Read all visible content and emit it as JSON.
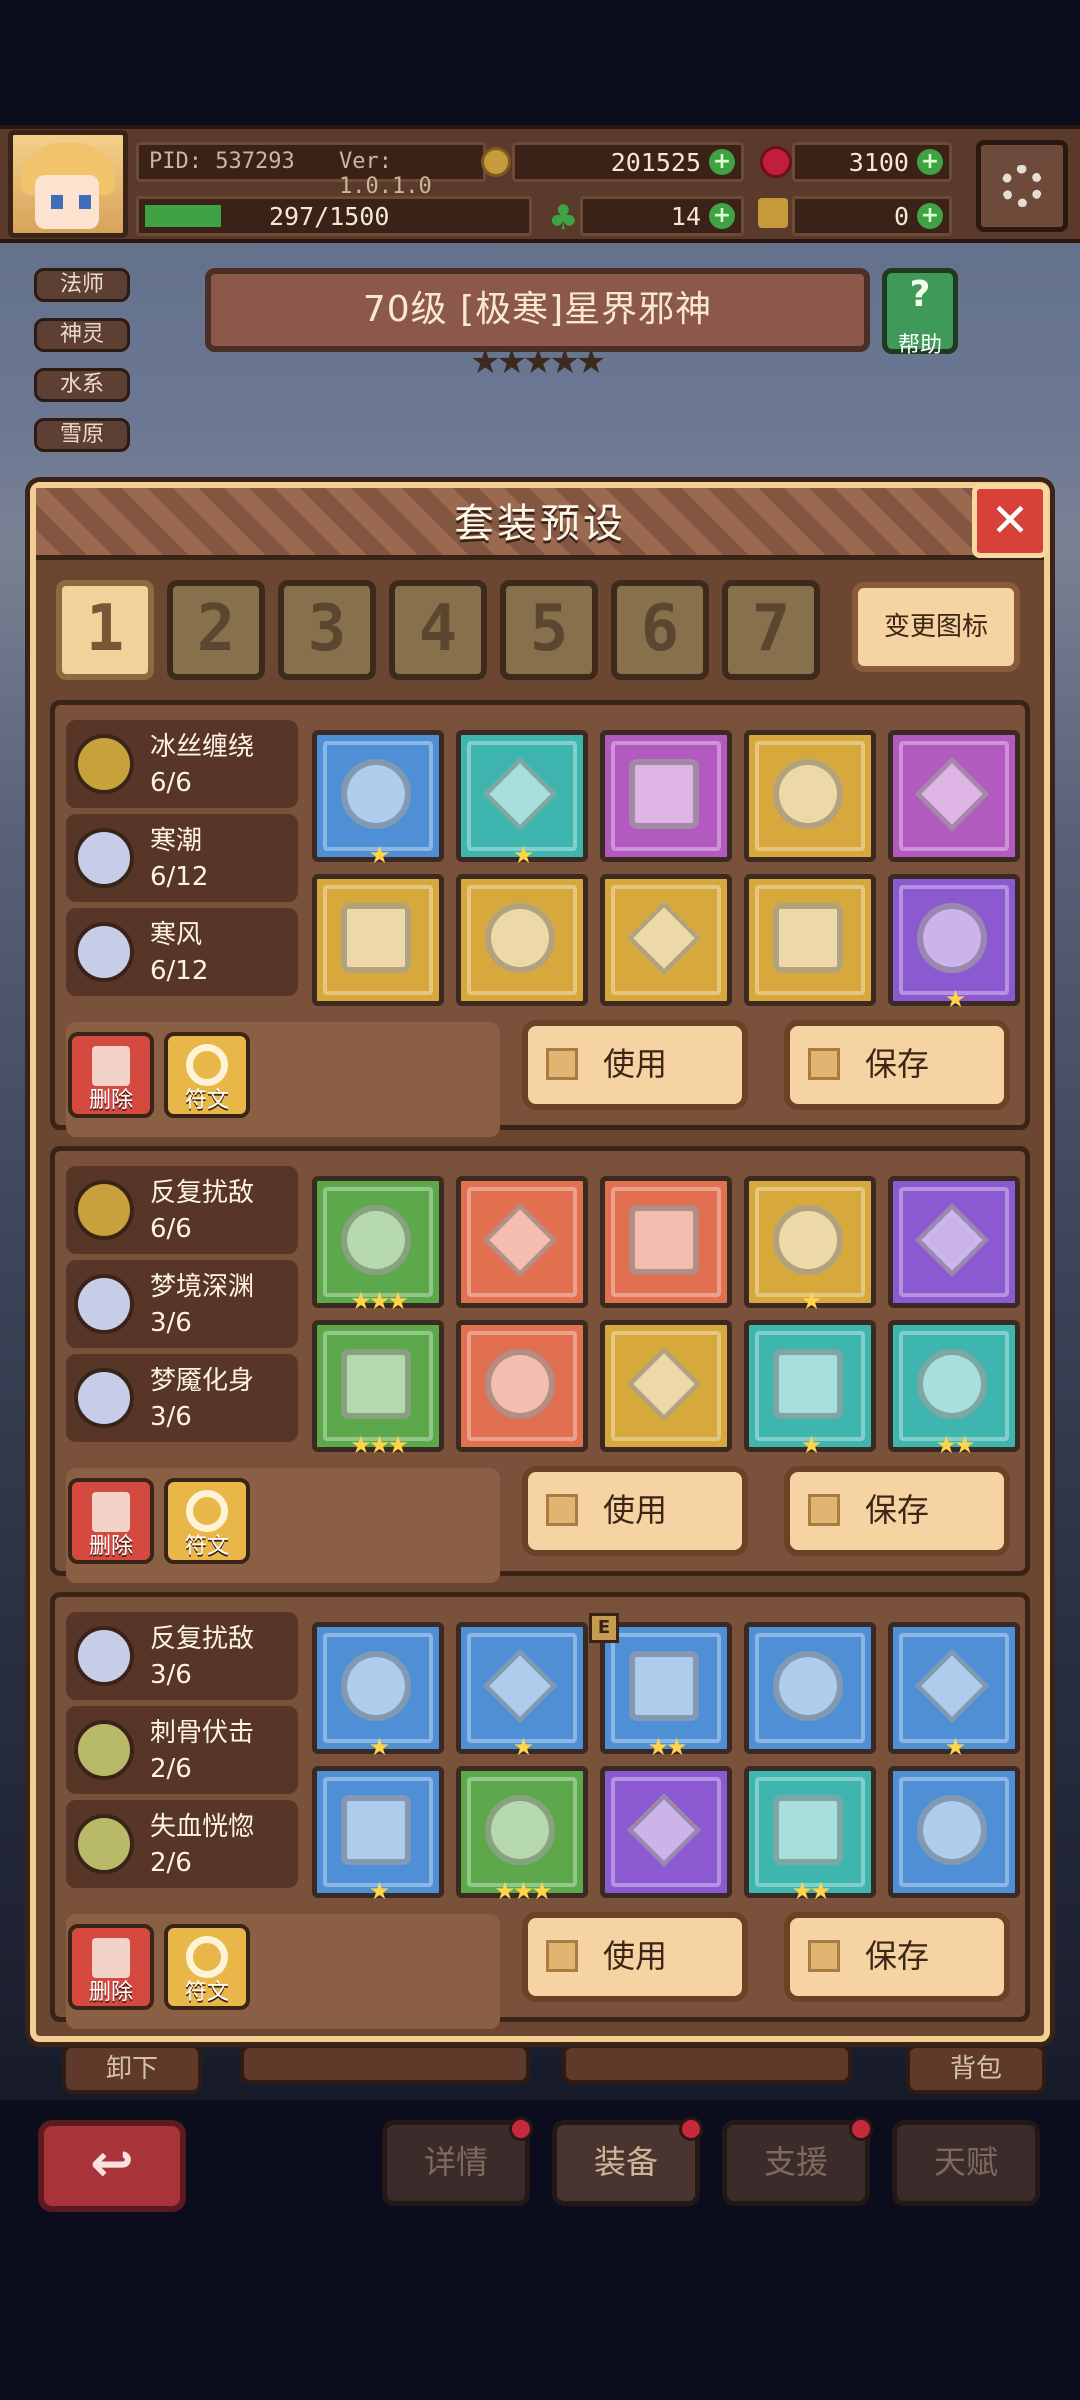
{
  "hud": {
    "pid": "PID: 537293",
    "version": "Ver: 1.0.1.0",
    "gold": "201525",
    "gems": "3100",
    "exp": "297/1500",
    "clover": "14",
    "keys": "0"
  },
  "tags": [
    "法师",
    "神灵",
    "水系",
    "雪原"
  ],
  "boss": {
    "title": "70级 [极寒]星界邪神",
    "stars": "★★★★★",
    "help_label": "帮助"
  },
  "dialog": {
    "title": "套装预设",
    "close_icon": "close-x-icon",
    "tabs": [
      "1",
      "2",
      "3",
      "4",
      "5",
      "6",
      "7"
    ],
    "active_tab": "1",
    "change_icon_label": "变更图标",
    "presets": [
      {
        "sets": [
          {
            "name": "冰丝缠绕",
            "count": "6/6",
            "color": "#c9a13c"
          },
          {
            "name": "寒潮",
            "count": "6/12",
            "color": "#c6cde8"
          },
          {
            "name": "寒风",
            "count": "6/12",
            "color": "#c6cde8"
          }
        ],
        "items": [
          {
            "icon": "staff-icon",
            "bg": "#4f8fd6",
            "stars": "★"
          },
          {
            "icon": "fire-orb-icon",
            "bg": "#3fb5b0",
            "stars": "★"
          },
          {
            "icon": "amulet-icon",
            "bg": "#b35ac0",
            "stars": ""
          },
          {
            "icon": "ice-crystal-icon",
            "bg": "#d7a93d",
            "stars": ""
          },
          {
            "icon": "ring-icon",
            "bg": "#b35ac0",
            "stars": ""
          },
          {
            "icon": "ice-crown-icon",
            "bg": "#d7a93d",
            "stars": ""
          },
          {
            "icon": "ice-armor-icon",
            "bg": "#d7a93d",
            "stars": ""
          },
          {
            "icon": "ice-gauntlet-icon",
            "bg": "#d7a93d",
            "stars": ""
          },
          {
            "icon": "belt-icon",
            "bg": "#d7a93d",
            "stars": ""
          },
          {
            "icon": "boots-icon",
            "bg": "#8c5ad0",
            "stars": "★"
          }
        ],
        "delete_label": "删除",
        "rune_label": "符文",
        "use_label": "使用",
        "save_label": "保存"
      },
      {
        "sets": [
          {
            "name": "反复扰敌",
            "count": "6/6",
            "color": "#c9a13c"
          },
          {
            "name": "梦境深渊",
            "count": "3/6",
            "color": "#c6cde8"
          },
          {
            "name": "梦魇化身",
            "count": "3/6",
            "color": "#c6cde8"
          }
        ],
        "items": [
          {
            "icon": "spear-icon",
            "bg": "#5ca84a",
            "stars": "★★★"
          },
          {
            "icon": "teddy-bear-icon",
            "bg": "#e07050",
            "stars": ""
          },
          {
            "icon": "heart-charm-icon",
            "bg": "#e07050",
            "stars": ""
          },
          {
            "icon": "heart-orb-icon",
            "bg": "#d7a93d",
            "stars": "★"
          },
          {
            "icon": "demon-ring-icon",
            "bg": "#8c5ad0",
            "stars": ""
          },
          {
            "icon": "horned-helm-icon",
            "bg": "#5ca84a",
            "stars": "★★★"
          },
          {
            "icon": "demon-armor-icon",
            "bg": "#e07050",
            "stars": ""
          },
          {
            "icon": "demon-gloves-icon",
            "bg": "#d7a93d",
            "stars": ""
          },
          {
            "icon": "chain-belt-icon",
            "bg": "#3fb5b0",
            "stars": "★"
          },
          {
            "icon": "silver-boots-icon",
            "bg": "#3fb5b0",
            "stars": "★★"
          }
        ],
        "delete_label": "删除",
        "rune_label": "符文",
        "use_label": "使用",
        "save_label": "保存"
      },
      {
        "sets": [
          {
            "name": "反复扰敌",
            "count": "3/6",
            "color": "#c6cde8"
          },
          {
            "name": "刺骨伏击",
            "count": "2/6",
            "color": "#b9b96a"
          },
          {
            "name": "失血恍惚",
            "count": "2/6",
            "color": "#b9b96a"
          }
        ],
        "items": [
          {
            "icon": "dark-sword-icon",
            "bg": "#4f8fd6",
            "stars": "★"
          },
          {
            "icon": "dagger-icon",
            "bg": "#4f8fd6",
            "stars": "★"
          },
          {
            "icon": "pendant-icon",
            "bg": "#4f8fd6",
            "stars": "★★",
            "badge": "E"
          },
          {
            "icon": "crystal-icon",
            "bg": "#4f8fd6",
            "stars": ""
          },
          {
            "icon": "silver-ring-icon",
            "bg": "#4f8fd6",
            "stars": "★"
          },
          {
            "icon": "leather-helm-icon",
            "bg": "#4f8fd6",
            "stars": "★"
          },
          {
            "icon": "leather-cloak-icon",
            "bg": "#5ca84a",
            "stars": "★★★"
          },
          {
            "icon": "pink-glove-icon",
            "bg": "#8c5ad0",
            "stars": ""
          },
          {
            "icon": "belt-ring-icon",
            "bg": "#3fb5b0",
            "stars": "★★"
          },
          {
            "icon": "crystal-boots-icon",
            "bg": "#4f8fd6",
            "stars": ""
          }
        ],
        "delete_label": "删除",
        "rune_label": "符文",
        "use_label": "使用",
        "save_label": "保存"
      }
    ]
  },
  "underlay": {
    "unequip": "卸下",
    "bag": "背包"
  },
  "nav": {
    "detail": "详情",
    "equip": "装备",
    "support": "支援",
    "talent": "天赋"
  }
}
